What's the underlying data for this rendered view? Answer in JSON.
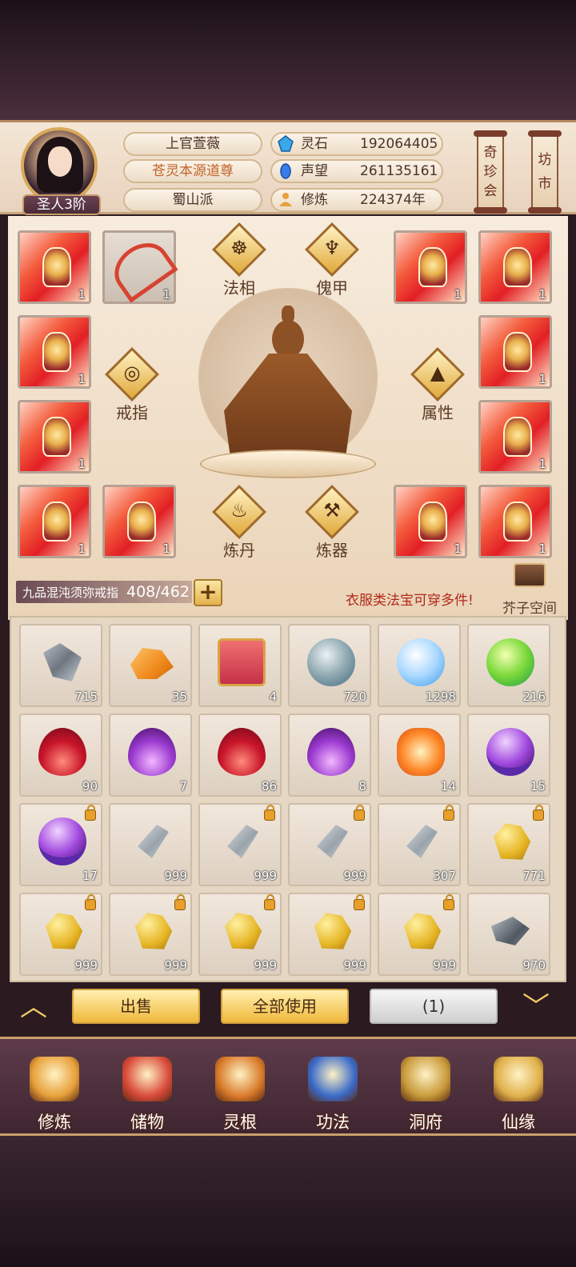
{
  "header": {
    "name": "上官萱薇",
    "title": "苍灵本源道尊",
    "sect": "蜀山派",
    "rank": "圣人3阶",
    "stats": [
      {
        "label": "灵石",
        "value": "192064405",
        "icon": "spirit-stone-icon",
        "color": "#3aa7e8"
      },
      {
        "label": "声望",
        "value": "261135161",
        "icon": "reputation-icon",
        "color": "#3a7de8"
      },
      {
        "label": "修炼",
        "value": "224374年",
        "icon": "meditation-icon",
        "color": "#e8a03a"
      }
    ],
    "side_buttons": [
      {
        "label": "奇珍会"
      },
      {
        "label": "坊市"
      }
    ]
  },
  "equipment": {
    "slots": [
      {
        "count": "1"
      },
      {
        "count": "1"
      },
      {
        "count": "1"
      },
      {
        "count": "1"
      },
      {
        "count": "1"
      },
      {
        "count": "1"
      },
      {
        "count": "1"
      },
      {
        "count": "1"
      },
      {
        "count": "1"
      },
      {
        "count": "1"
      },
      {
        "count": "1"
      },
      {
        "count": "1"
      }
    ],
    "functions": [
      "法相",
      "傀甲",
      "戒指",
      "属性",
      "炼丹",
      "炼器"
    ]
  },
  "storage": {
    "name": "九品混沌须弥戒指",
    "count": "408/462",
    "add": "+",
    "hint": "衣服类法宝可穿多件!",
    "space_label": "芥子空间"
  },
  "inventory": [
    {
      "count": "715",
      "art": "shards",
      "locked": false
    },
    {
      "count": "35",
      "art": "gold",
      "locked": false
    },
    {
      "count": "4",
      "art": "box",
      "locked": false
    },
    {
      "count": "720",
      "art": "orb-grey",
      "locked": false
    },
    {
      "count": "1298",
      "art": "orb-blue",
      "locked": false
    },
    {
      "count": "216",
      "art": "orb-green",
      "locked": false
    },
    {
      "count": "90",
      "art": "flame-red",
      "locked": false
    },
    {
      "count": "7",
      "art": "flame-purple",
      "locked": false
    },
    {
      "count": "86",
      "art": "flame-red",
      "locked": false
    },
    {
      "count": "8",
      "art": "flame-purple",
      "locked": false
    },
    {
      "count": "14",
      "art": "swirl",
      "locked": false
    },
    {
      "count": "15",
      "art": "crystal",
      "locked": false
    },
    {
      "count": "17",
      "art": "crystal",
      "locked": true
    },
    {
      "count": "999",
      "art": "silver",
      "locked": false
    },
    {
      "count": "999",
      "art": "silver",
      "locked": true
    },
    {
      "count": "999",
      "art": "silver",
      "locked": true
    },
    {
      "count": "307",
      "art": "silver",
      "locked": true
    },
    {
      "count": "771",
      "art": "nugget",
      "locked": true
    },
    {
      "count": "999",
      "art": "nugget",
      "locked": true
    },
    {
      "count": "999",
      "art": "nugget",
      "locked": true
    },
    {
      "count": "999",
      "art": "nugget",
      "locked": true
    },
    {
      "count": "999",
      "art": "nugget",
      "locked": true
    },
    {
      "count": "999",
      "art": "nugget",
      "locked": true
    },
    {
      "count": "970",
      "art": "ingot",
      "locked": false
    }
  ],
  "actions": {
    "up": "︿",
    "sell": "出售",
    "use_all": "全部使用",
    "selected": "(1)",
    "down": "﹀"
  },
  "nav": [
    {
      "label": "修炼",
      "icon": "cultivate-icon",
      "color": "#e8a03a"
    },
    {
      "label": "储物",
      "icon": "storage-bag-icon",
      "color": "#d94a3a"
    },
    {
      "label": "灵根",
      "icon": "spirit-root-icon",
      "color": "#d97a2a"
    },
    {
      "label": "功法",
      "icon": "book-icon",
      "color": "#3a6ac8"
    },
    {
      "label": "洞府",
      "icon": "cave-house-icon",
      "color": "#c89a3a"
    },
    {
      "label": "仙缘",
      "icon": "gourd-icon",
      "color": "#e0b04a"
    }
  ]
}
